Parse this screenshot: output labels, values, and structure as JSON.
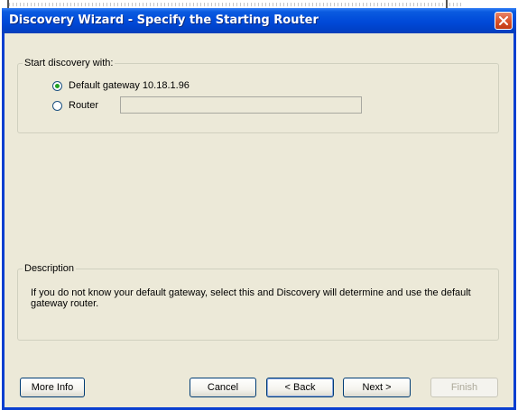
{
  "window": {
    "title": "Discovery Wizard - Specify the Starting Router"
  },
  "start_group": {
    "legend": "Start discovery with:",
    "options": [
      {
        "label": "Default gateway 10.18.1.96",
        "checked": true
      },
      {
        "label": "Router",
        "checked": false
      }
    ],
    "router_value": ""
  },
  "description": {
    "legend": "Description",
    "text": "If you do not know your default gateway, select this and Discovery will determine and use the default gateway router."
  },
  "buttons": {
    "more_info": "More Info",
    "cancel": "Cancel",
    "back": "< Back",
    "next": "Next >",
    "finish": "Finish"
  },
  "icons": {
    "close": "close-icon"
  }
}
